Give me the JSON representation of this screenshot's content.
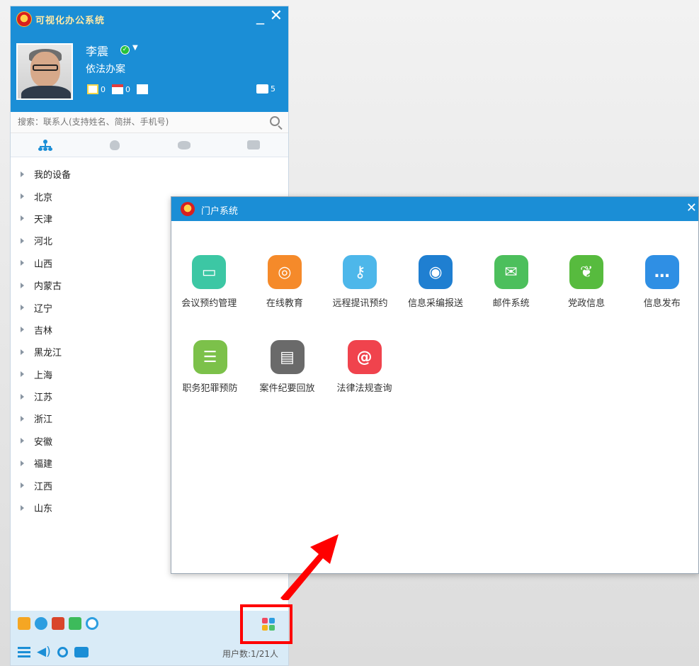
{
  "app": {
    "title": "可视化办公系统",
    "minimize": "_",
    "close": "✕"
  },
  "user": {
    "name": "李震",
    "status": "在线",
    "signature": "依法办案",
    "counters": [
      {
        "icon": "edit-note-icon",
        "value": "0"
      },
      {
        "icon": "calendar-icon",
        "value": "0"
      },
      {
        "icon": "mail-icon",
        "value": ""
      }
    ],
    "messages": {
      "icon": "message-box-icon",
      "value": "5"
    }
  },
  "search": {
    "placeholder": "搜索：联系人(支持姓名、简拼、手机号)"
  },
  "tabs": [
    {
      "icon": "org-tree-icon"
    },
    {
      "icon": "contact-icon"
    },
    {
      "icon": "group-icon"
    },
    {
      "icon": "chat-icon"
    }
  ],
  "tree": [
    "我的设备",
    "北京",
    "天津",
    "河北",
    "山西",
    "内蒙古",
    "辽宁",
    "吉林",
    "黑龙江",
    "上海",
    "江苏",
    "浙江",
    "安徽",
    "福建",
    "江西",
    "山东"
  ],
  "footer": {
    "user_count": "用户数:1/21人"
  },
  "portal": {
    "title": "门户系统",
    "close": "✕",
    "apps_row1": [
      {
        "label": "会议预约管理",
        "icon": "meeting-booking-icon",
        "color": "#3cc7a4"
      },
      {
        "label": "在线教育",
        "icon": "headset-icon",
        "color": "#f58a2a"
      },
      {
        "label": "远程提讯预约",
        "icon": "key-icon",
        "color": "#4db7ea"
      },
      {
        "label": "信息采编报送",
        "icon": "swirl-globe-icon",
        "color": "#1f7fd1"
      },
      {
        "label": "邮件系统",
        "icon": "mailbox-icon",
        "color": "#4cbf5c"
      },
      {
        "label": "党政信息",
        "icon": "leaf-icon",
        "color": "#57bb3e"
      },
      {
        "label": "信息发布",
        "icon": "speech-bubble-icon",
        "color": "#2f8fe4"
      }
    ],
    "apps_row2": [
      {
        "label": "职务犯罪预防",
        "icon": "server-icon",
        "color": "#7cc14a"
      },
      {
        "label": "案件纪要回放",
        "icon": "hard-disk-icon",
        "color": "#6a6a6a"
      },
      {
        "label": "法律法规查询",
        "icon": "at-sign-icon",
        "color": "#f0434d"
      }
    ]
  },
  "colors": {
    "accent": "#1b8ed6",
    "highlight": "#ff0000"
  }
}
